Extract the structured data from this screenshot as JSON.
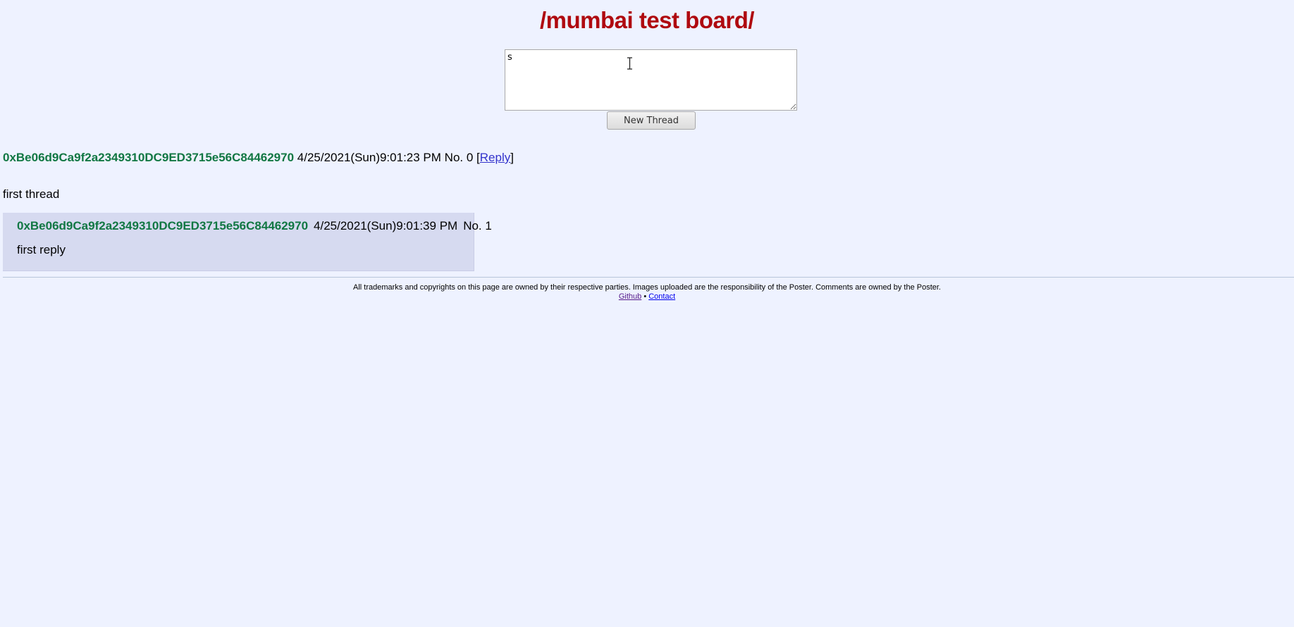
{
  "board": {
    "title": "/mumbai test board/"
  },
  "form": {
    "textarea_value": "s",
    "submit_label": "New Thread"
  },
  "thread": {
    "poster_id": "0xBe06d9Ca9f2a2349310DC9ED3715e56C84462970",
    "date": "4/25/2021(Sun)9:01:23 PM",
    "number": "No. 0",
    "reply_open": "[",
    "reply_label": "Reply",
    "reply_close": "]",
    "body": "first thread"
  },
  "replies": [
    {
      "poster_id": "0xBe06d9Ca9f2a2349310DC9ED3715e56C84462970",
      "date": "4/25/2021(Sun)9:01:39 PM",
      "number": "No. 1",
      "body": "first reply"
    }
  ],
  "footer": {
    "disclaimer": "All trademarks and copyrights on this page are owned by their respective parties. Images uploaded are the responsibility of the Poster. Comments are owned by the Poster.",
    "github_label": "Github",
    "separator": " • ",
    "contact_label": "Contact"
  },
  "colors": {
    "background": "#eef2ff",
    "title": "#af0a0f",
    "poster_id": "#117743",
    "reply_background": "#d6daf0"
  },
  "icons": {
    "text_cursor": "i-beam-cursor-icon"
  }
}
